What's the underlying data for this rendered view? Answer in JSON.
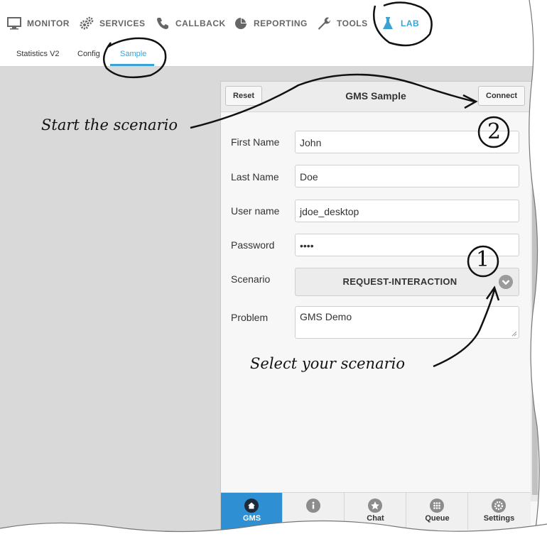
{
  "nav": {
    "items": [
      {
        "label": "MONITOR",
        "icon": "monitor-icon"
      },
      {
        "label": "SERVICES",
        "icon": "gears-icon"
      },
      {
        "label": "CALLBACK",
        "icon": "phone-icon"
      },
      {
        "label": "REPORTING",
        "icon": "pie-chart-icon"
      },
      {
        "label": "TOOLS",
        "icon": "wrench-icon"
      },
      {
        "label": "LAB",
        "icon": "flask-icon",
        "active": true
      }
    ],
    "active_color": "#3aa3d6"
  },
  "subnav": {
    "items": [
      {
        "label": "Statistics V2"
      },
      {
        "label": "Config"
      },
      {
        "label": "Sample",
        "active": true
      }
    ]
  },
  "panel": {
    "title": "GMS Sample",
    "reset_label": "Reset",
    "connect_label": "Connect",
    "fields": {
      "first_name": {
        "label": "First Name",
        "value": "John"
      },
      "last_name": {
        "label": "Last Name",
        "value": "Doe"
      },
      "user_name": {
        "label": "User name",
        "value": "jdoe_desktop"
      },
      "password": {
        "label": "Password",
        "value": "••••"
      },
      "scenario": {
        "label": "Scenario",
        "value": "REQUEST-INTERACTION"
      },
      "problem": {
        "label": "Problem",
        "value": "GMS Demo"
      }
    },
    "tabs": [
      {
        "label": "GMS",
        "icon": "home-icon",
        "active": true
      },
      {
        "label": "",
        "icon": "info-icon"
      },
      {
        "label": "Chat",
        "icon": "star-icon"
      },
      {
        "label": "Queue",
        "icon": "grid-icon"
      },
      {
        "label": "Settings",
        "icon": "settings-icon"
      }
    ],
    "active_tab_color": "#2f8fd3"
  },
  "annotations": {
    "start": "Start the scenario",
    "select": "Select your scenario",
    "marker_1": "1",
    "marker_2": "2"
  }
}
